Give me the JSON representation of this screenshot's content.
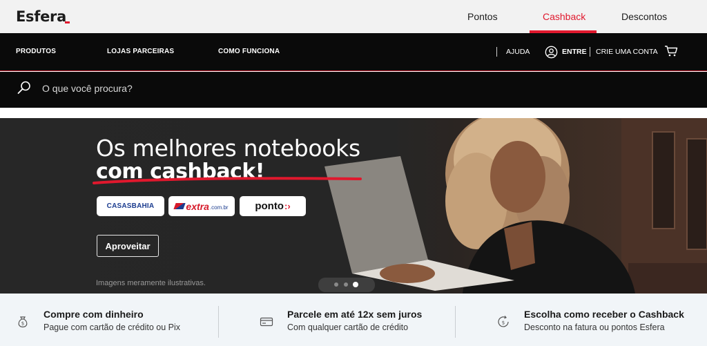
{
  "brand": {
    "name": "Esfera",
    "accent": "#e0182d"
  },
  "top_tabs": [
    {
      "label": "Pontos",
      "active": false
    },
    {
      "label": "Cashback",
      "active": true
    },
    {
      "label": "Descontos",
      "active": false
    }
  ],
  "nav": {
    "items": [
      "PRODUTOS",
      "LOJAS PARCEIRAS",
      "COMO FUNCIONA"
    ],
    "help": "AJUDA",
    "login": "ENTRE",
    "signup": "CRIE UMA CONTA",
    "icons": [
      "user-icon",
      "cart-icon"
    ]
  },
  "search": {
    "placeholder": "O que você procura?",
    "value": "",
    "icon": "search-icon"
  },
  "hero": {
    "title_line1": "Os melhores notebooks",
    "title_line2": "com cashback!",
    "stores": [
      "CASASBAHIA",
      "extra",
      ".com.br",
      "ponto"
    ],
    "cta": "Aproveitar",
    "disclaimer": "Imagens meramente ilustrativas.",
    "carousel": {
      "total": 3,
      "active": 3
    }
  },
  "benefits": [
    {
      "title": "Compre com dinheiro",
      "subtitle": "Pague com cartão de crédito ou Pix",
      "icon": "money-bag-icon"
    },
    {
      "title": "Parcele em até 12x sem juros",
      "subtitle": "Com qualquer cartão de crédito",
      "icon": "credit-card-icon"
    },
    {
      "title": "Escolha como receber o Cashback",
      "subtitle": "Desconto na fatura ou pontos Esfera",
      "icon": "cashback-coin-icon"
    }
  ]
}
